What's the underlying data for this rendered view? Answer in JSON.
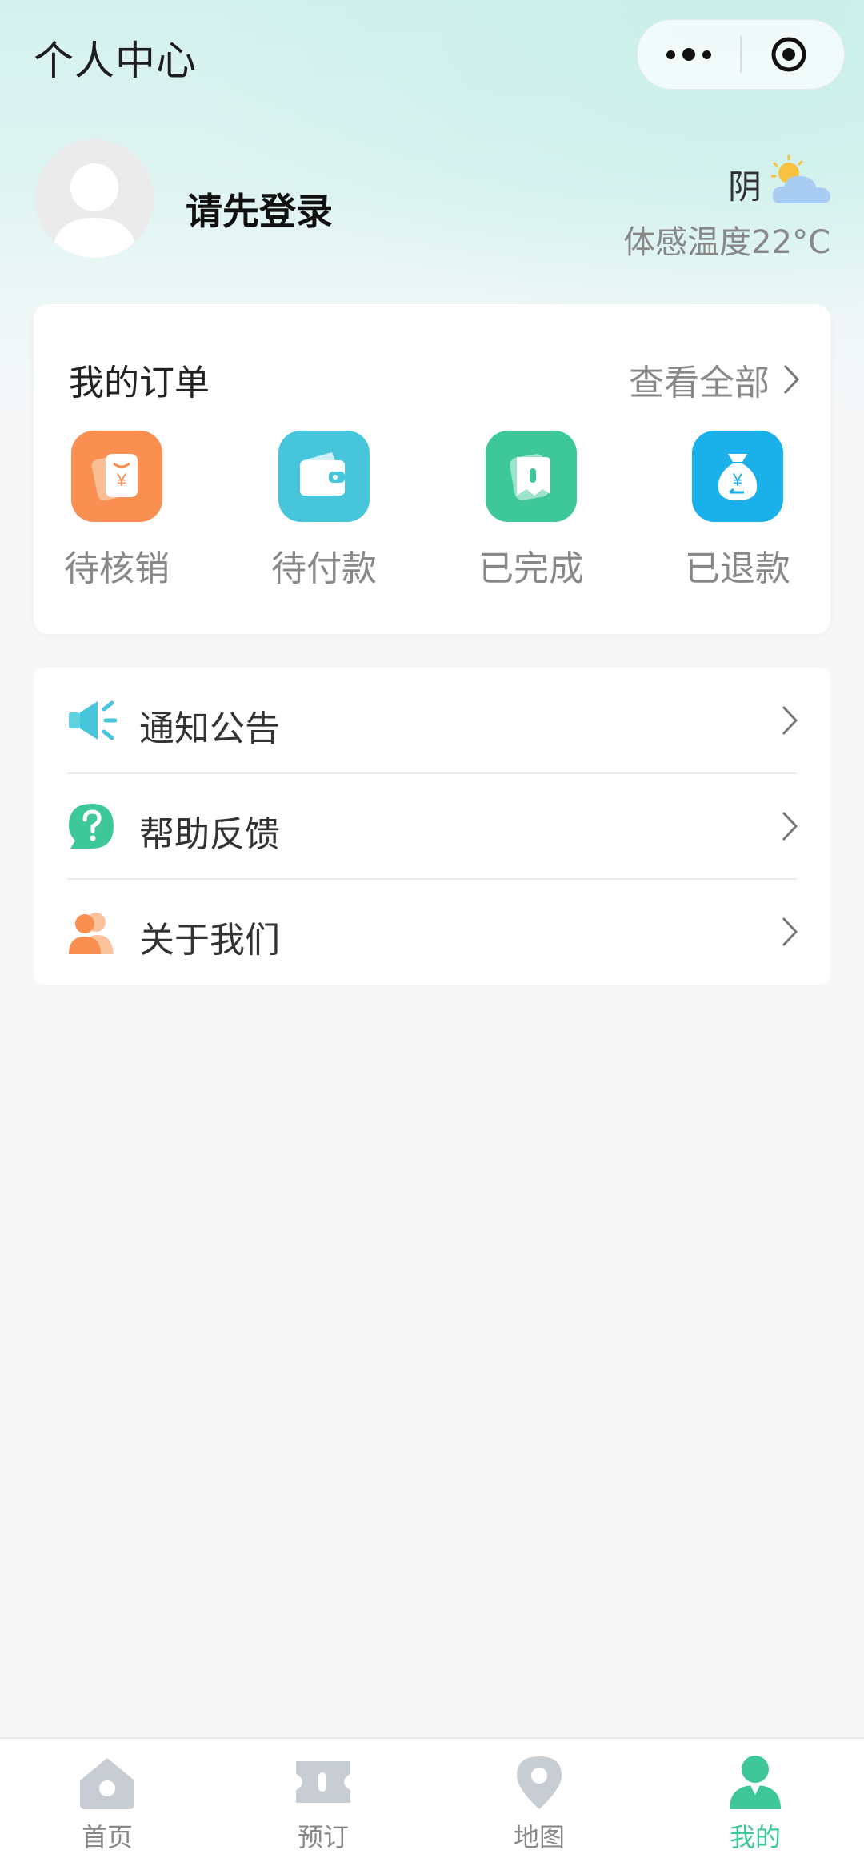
{
  "header": {
    "title": "个人中心"
  },
  "user": {
    "login_prompt": "请先登录"
  },
  "weather": {
    "condition": "阴",
    "feels_like": "体感温度22°C",
    "icon": "cloudy-sun-icon"
  },
  "orders": {
    "title": "我的订单",
    "view_all": "查看全部",
    "items": [
      {
        "label": "待核销",
        "icon": "voucher-icon",
        "color": "#f98f50"
      },
      {
        "label": "待付款",
        "icon": "wallet-icon",
        "color": "#47c5db"
      },
      {
        "label": "已完成",
        "icon": "done-icon",
        "color": "#3ec89a"
      },
      {
        "label": "已退款",
        "icon": "refund-bag-icon",
        "color": "#1ab0ea"
      }
    ]
  },
  "menu": {
    "items": [
      {
        "label": "通知公告",
        "icon": "megaphone-icon"
      },
      {
        "label": "帮助反馈",
        "icon": "help-icon"
      },
      {
        "label": "关于我们",
        "icon": "people-icon"
      }
    ]
  },
  "tabbar": {
    "items": [
      {
        "label": "首页",
        "icon": "home-icon"
      },
      {
        "label": "预订",
        "icon": "ticket-icon"
      },
      {
        "label": "地图",
        "icon": "map-pin-icon"
      },
      {
        "label": "我的",
        "icon": "user-icon",
        "active": true
      }
    ],
    "active_color": "#3ec89a"
  }
}
